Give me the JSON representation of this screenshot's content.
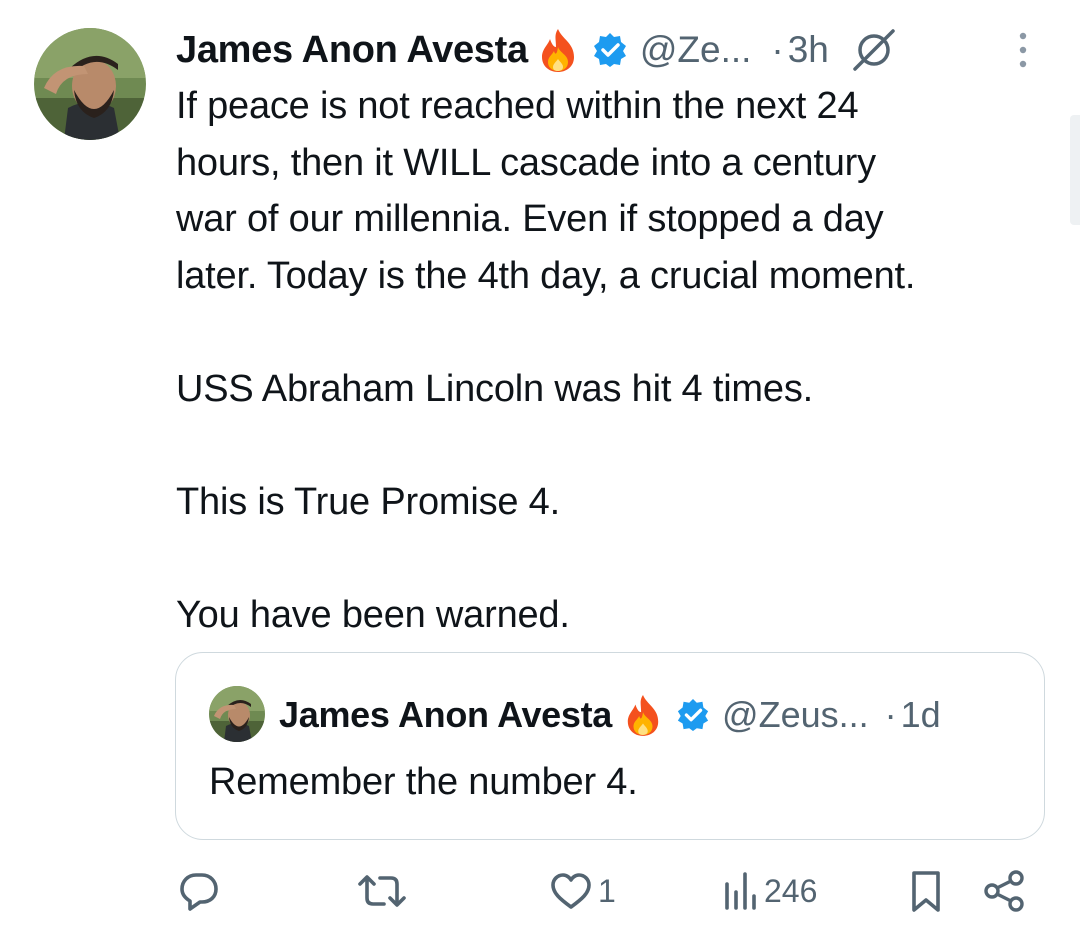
{
  "tweet": {
    "author_name": "James Anon Avesta",
    "handle": "@Ze...",
    "separator": "·",
    "time": "3h",
    "text": "If peace is not reached within the next 24\nhours, then it WILL cascade into a century\nwar of our millennia. Even if stopped a day\nlater. Today is the 4th day, a crucial moment.\n\nUSS Abraham Lincoln was hit 4 times.\n\nThis is True Promise 4.\n\nYou have been warned."
  },
  "quote": {
    "author_name": "James Anon Avesta",
    "handle": "@Zeus...",
    "separator": "·",
    "time": "1d",
    "text": "Remember the number 4."
  },
  "actions": {
    "reply_count": "",
    "repost_count": "",
    "like_count": "1",
    "views_count": "246"
  },
  "icons": [
    "fire-icon",
    "verified-icon",
    "grok-icon",
    "more-icon",
    "reply-icon",
    "repost-icon",
    "like-icon",
    "views-icon",
    "bookmark-icon",
    "share-icon"
  ],
  "colors": {
    "text": "#0f1419",
    "secondary": "#536471",
    "verified": "#1d9bf0",
    "border": "#cfd9de"
  }
}
